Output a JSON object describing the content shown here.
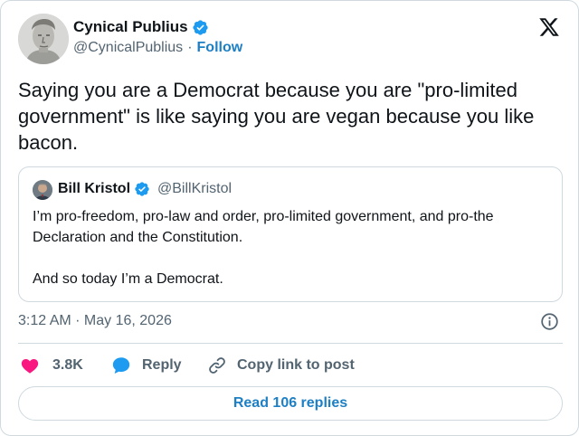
{
  "author": {
    "display_name": "Cynical Publius",
    "handle": "@CynicalPublius",
    "separator": "·",
    "follow_label": "Follow"
  },
  "tweet": {
    "text": "Saying you are a Democrat because you are \"pro-limited government\" is like saying you are vegan because you like bacon."
  },
  "quote": {
    "display_name": "Bill Kristol",
    "handle": "@BillKristol",
    "paragraphs": [
      "I’m pro-freedom, pro-law and order, pro-limited government, and pro-the Declaration and the Constitution.",
      "And so today I’m a Democrat."
    ]
  },
  "meta": {
    "timestamp": "3:12 AM · May 16, 2026"
  },
  "actions": {
    "like_count": "3.8K",
    "reply_label": "Reply",
    "copy_label": "Copy link to post"
  },
  "replies_button": "Read 106 replies",
  "colors": {
    "verified_blue": "#1d9bf0",
    "link_blue": "#1d7fc4",
    "like_pink": "#f91880",
    "secondary_text": "#536471",
    "border": "#cfd9de"
  },
  "icons": {
    "platform": "x-logo-icon",
    "verified": "verified-badge-icon",
    "info": "info-icon",
    "like": "heart-icon",
    "reply": "speech-bubble-icon",
    "copy": "link-icon"
  }
}
